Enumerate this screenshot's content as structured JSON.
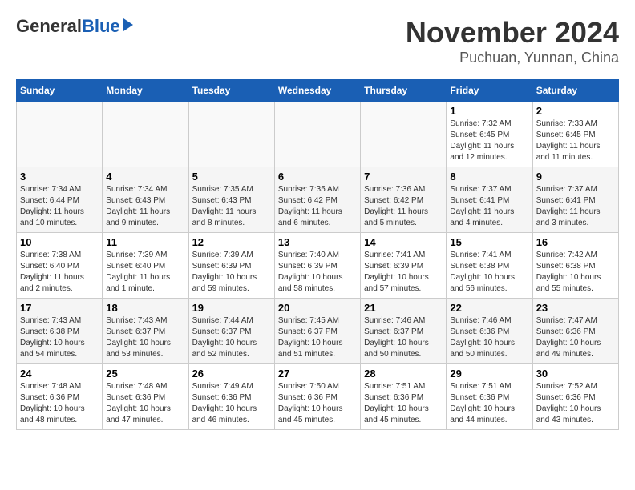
{
  "header": {
    "logo_general": "General",
    "logo_blue": "Blue",
    "month_title": "November 2024",
    "location": "Puchuan, Yunnan, China"
  },
  "weekdays": [
    "Sunday",
    "Monday",
    "Tuesday",
    "Wednesday",
    "Thursday",
    "Friday",
    "Saturday"
  ],
  "weeks": [
    [
      {
        "day": "",
        "info": ""
      },
      {
        "day": "",
        "info": ""
      },
      {
        "day": "",
        "info": ""
      },
      {
        "day": "",
        "info": ""
      },
      {
        "day": "",
        "info": ""
      },
      {
        "day": "1",
        "info": "Sunrise: 7:32 AM\nSunset: 6:45 PM\nDaylight: 11 hours and 12 minutes."
      },
      {
        "day": "2",
        "info": "Sunrise: 7:33 AM\nSunset: 6:45 PM\nDaylight: 11 hours and 11 minutes."
      }
    ],
    [
      {
        "day": "3",
        "info": "Sunrise: 7:34 AM\nSunset: 6:44 PM\nDaylight: 11 hours and 10 minutes."
      },
      {
        "day": "4",
        "info": "Sunrise: 7:34 AM\nSunset: 6:43 PM\nDaylight: 11 hours and 9 minutes."
      },
      {
        "day": "5",
        "info": "Sunrise: 7:35 AM\nSunset: 6:43 PM\nDaylight: 11 hours and 8 minutes."
      },
      {
        "day": "6",
        "info": "Sunrise: 7:35 AM\nSunset: 6:42 PM\nDaylight: 11 hours and 6 minutes."
      },
      {
        "day": "7",
        "info": "Sunrise: 7:36 AM\nSunset: 6:42 PM\nDaylight: 11 hours and 5 minutes."
      },
      {
        "day": "8",
        "info": "Sunrise: 7:37 AM\nSunset: 6:41 PM\nDaylight: 11 hours and 4 minutes."
      },
      {
        "day": "9",
        "info": "Sunrise: 7:37 AM\nSunset: 6:41 PM\nDaylight: 11 hours and 3 minutes."
      }
    ],
    [
      {
        "day": "10",
        "info": "Sunrise: 7:38 AM\nSunset: 6:40 PM\nDaylight: 11 hours and 2 minutes."
      },
      {
        "day": "11",
        "info": "Sunrise: 7:39 AM\nSunset: 6:40 PM\nDaylight: 11 hours and 1 minute."
      },
      {
        "day": "12",
        "info": "Sunrise: 7:39 AM\nSunset: 6:39 PM\nDaylight: 10 hours and 59 minutes."
      },
      {
        "day": "13",
        "info": "Sunrise: 7:40 AM\nSunset: 6:39 PM\nDaylight: 10 hours and 58 minutes."
      },
      {
        "day": "14",
        "info": "Sunrise: 7:41 AM\nSunset: 6:39 PM\nDaylight: 10 hours and 57 minutes."
      },
      {
        "day": "15",
        "info": "Sunrise: 7:41 AM\nSunset: 6:38 PM\nDaylight: 10 hours and 56 minutes."
      },
      {
        "day": "16",
        "info": "Sunrise: 7:42 AM\nSunset: 6:38 PM\nDaylight: 10 hours and 55 minutes."
      }
    ],
    [
      {
        "day": "17",
        "info": "Sunrise: 7:43 AM\nSunset: 6:38 PM\nDaylight: 10 hours and 54 minutes."
      },
      {
        "day": "18",
        "info": "Sunrise: 7:43 AM\nSunset: 6:37 PM\nDaylight: 10 hours and 53 minutes."
      },
      {
        "day": "19",
        "info": "Sunrise: 7:44 AM\nSunset: 6:37 PM\nDaylight: 10 hours and 52 minutes."
      },
      {
        "day": "20",
        "info": "Sunrise: 7:45 AM\nSunset: 6:37 PM\nDaylight: 10 hours and 51 minutes."
      },
      {
        "day": "21",
        "info": "Sunrise: 7:46 AM\nSunset: 6:37 PM\nDaylight: 10 hours and 50 minutes."
      },
      {
        "day": "22",
        "info": "Sunrise: 7:46 AM\nSunset: 6:36 PM\nDaylight: 10 hours and 50 minutes."
      },
      {
        "day": "23",
        "info": "Sunrise: 7:47 AM\nSunset: 6:36 PM\nDaylight: 10 hours and 49 minutes."
      }
    ],
    [
      {
        "day": "24",
        "info": "Sunrise: 7:48 AM\nSunset: 6:36 PM\nDaylight: 10 hours and 48 minutes."
      },
      {
        "day": "25",
        "info": "Sunrise: 7:48 AM\nSunset: 6:36 PM\nDaylight: 10 hours and 47 minutes."
      },
      {
        "day": "26",
        "info": "Sunrise: 7:49 AM\nSunset: 6:36 PM\nDaylight: 10 hours and 46 minutes."
      },
      {
        "day": "27",
        "info": "Sunrise: 7:50 AM\nSunset: 6:36 PM\nDaylight: 10 hours and 45 minutes."
      },
      {
        "day": "28",
        "info": "Sunrise: 7:51 AM\nSunset: 6:36 PM\nDaylight: 10 hours and 45 minutes."
      },
      {
        "day": "29",
        "info": "Sunrise: 7:51 AM\nSunset: 6:36 PM\nDaylight: 10 hours and 44 minutes."
      },
      {
        "day": "30",
        "info": "Sunrise: 7:52 AM\nSunset: 6:36 PM\nDaylight: 10 hours and 43 minutes."
      }
    ]
  ]
}
